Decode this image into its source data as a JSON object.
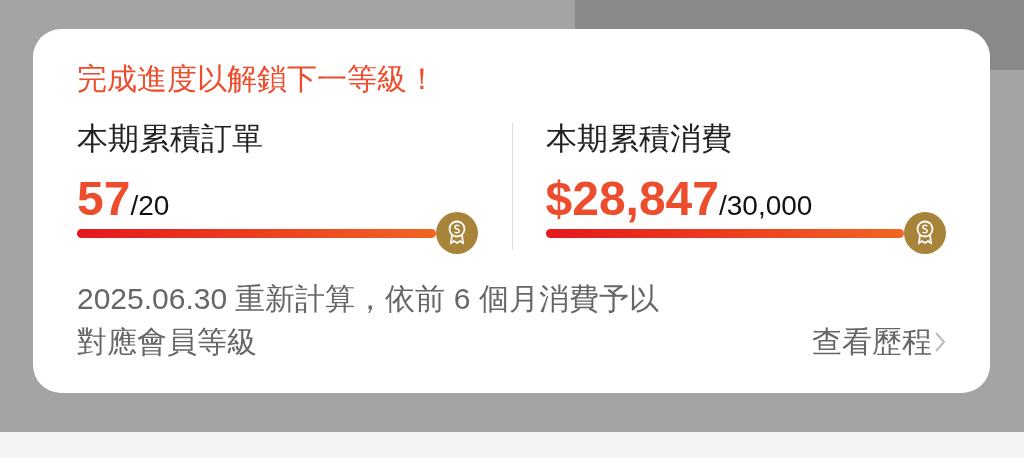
{
  "card": {
    "headline": "完成進度以解鎖下一等級！",
    "metrics": [
      {
        "label": "本期累積訂單",
        "value": "57",
        "target": "/20"
      },
      {
        "label": "本期累積消費",
        "value": "$28,847",
        "target": "/30,000"
      }
    ],
    "note": "2025.06.30 重新計算，依前 6 個月消費予以對應會員等級",
    "history_link": "查看歷程"
  }
}
